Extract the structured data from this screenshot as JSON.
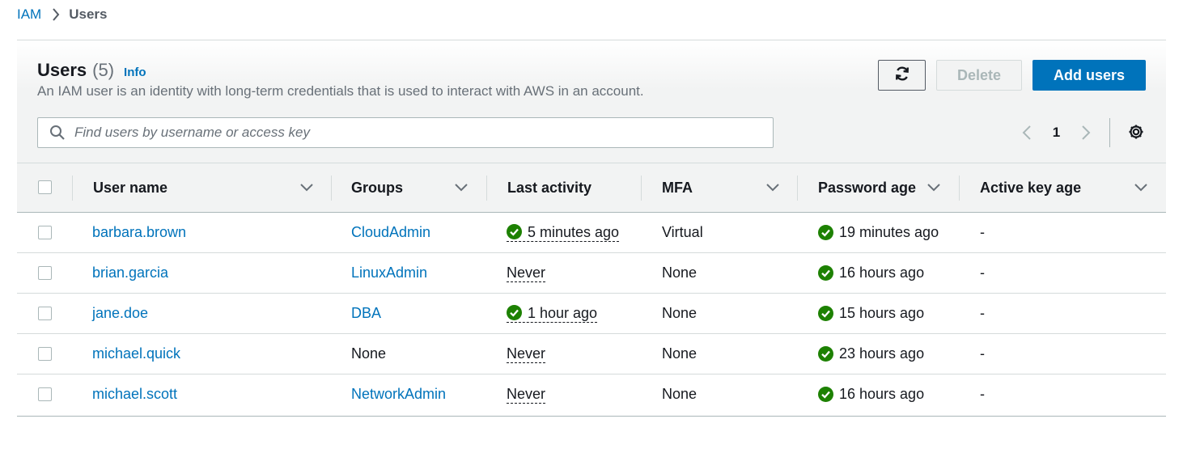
{
  "breadcrumb": {
    "root": "IAM",
    "current": "Users"
  },
  "header": {
    "title": "Users",
    "count": "(5)",
    "info": "Info",
    "description": "An IAM user is an identity with long-term credentials that is used to interact with AWS in an account."
  },
  "toolbar": {
    "delete_label": "Delete",
    "add_label": "Add users"
  },
  "search": {
    "placeholder": "Find users by username or access key",
    "value": ""
  },
  "pagination": {
    "current_page": "1"
  },
  "table": {
    "columns": {
      "user_name": "User name",
      "groups": "Groups",
      "last_activity": "Last activity",
      "mfa": "MFA",
      "password_age": "Password age",
      "active_key_age": "Active key age"
    },
    "rows": [
      {
        "user_name": "barbara.brown",
        "groups": "CloudAdmin",
        "last_activity": "5 minutes ago",
        "mfa": "Virtual",
        "password_age": "19 minutes ago",
        "active_key_age": "-"
      },
      {
        "user_name": "brian.garcia",
        "groups": "LinuxAdmin",
        "last_activity": "Never",
        "mfa": "None",
        "password_age": "16 hours ago",
        "active_key_age": "-"
      },
      {
        "user_name": "jane.doe",
        "groups": "DBA",
        "last_activity": "1 hour ago",
        "mfa": "None",
        "password_age": "15 hours ago",
        "active_key_age": "-"
      },
      {
        "user_name": "michael.quick",
        "groups": "None",
        "last_activity": "Never",
        "mfa": "None",
        "password_age": "23 hours ago",
        "active_key_age": "-"
      },
      {
        "user_name": "michael.scott",
        "groups": "NetworkAdmin",
        "last_activity": "Never",
        "mfa": "None",
        "password_age": "16 hours ago",
        "active_key_age": "-"
      }
    ]
  },
  "colors": {
    "link": "#0073bb",
    "primary_button": "#0073bb",
    "success": "#1d8102",
    "header_bg": "#f2f3f3"
  }
}
